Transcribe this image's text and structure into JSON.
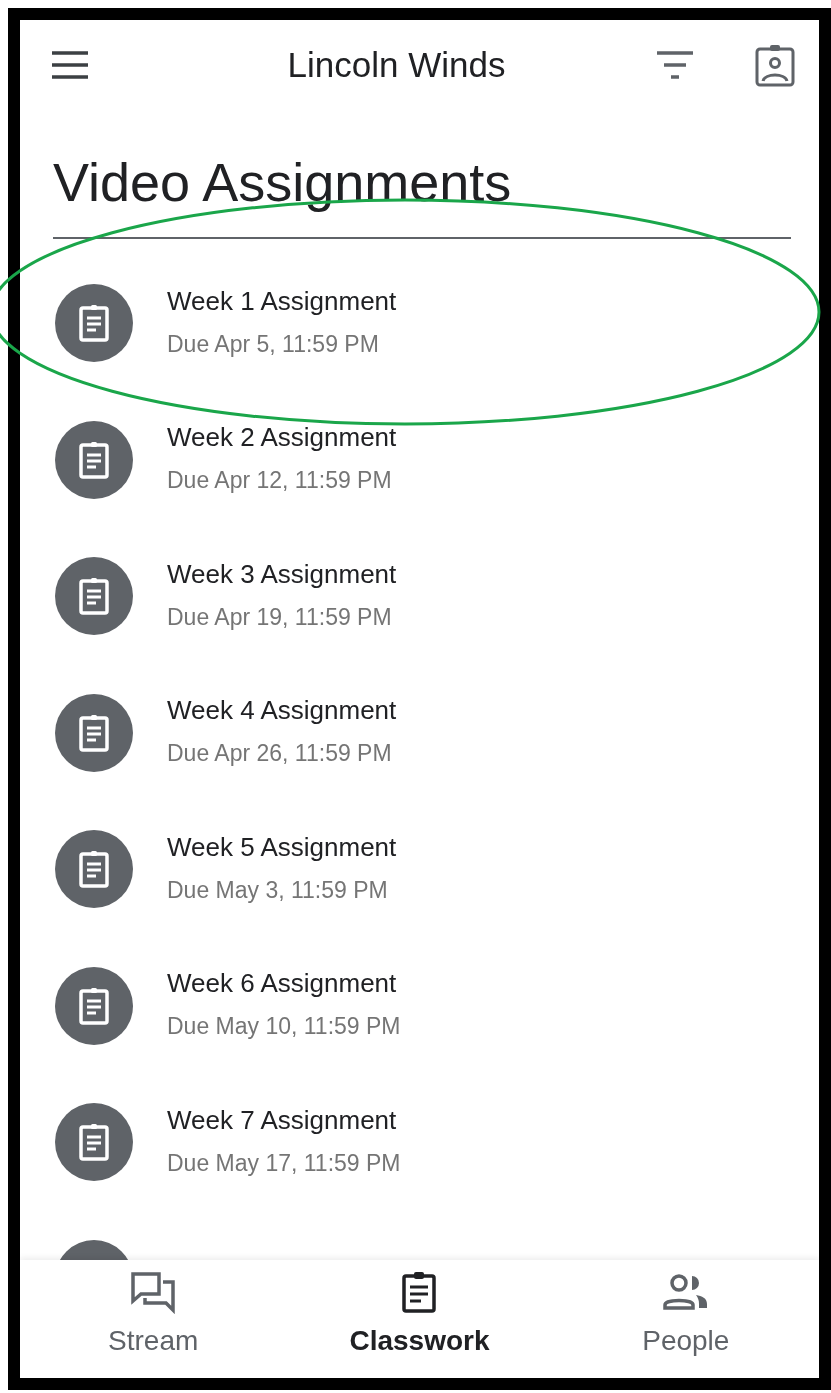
{
  "app_bar": {
    "title": "Lincoln Winds"
  },
  "topic": {
    "title": "Video Assignments"
  },
  "assignments": [
    {
      "title": "Week 1 Assignment",
      "due": "Due Apr 5, 11:59 PM"
    },
    {
      "title": "Week 2 Assignment",
      "due": "Due Apr 12, 11:59 PM"
    },
    {
      "title": "Week 3 Assignment",
      "due": "Due Apr 19, 11:59 PM"
    },
    {
      "title": "Week 4 Assignment",
      "due": "Due Apr 26, 11:59 PM"
    },
    {
      "title": "Week 5 Assignment",
      "due": "Due May 3, 11:59 PM"
    },
    {
      "title": "Week 6 Assignment",
      "due": "Due May 10, 11:59 PM"
    },
    {
      "title": "Week 7 Assignment",
      "due": "Due May 17, 11:59 PM"
    }
  ],
  "bottom_nav": [
    {
      "kind": "stream",
      "label": "Stream",
      "selected": false
    },
    {
      "kind": "classwork",
      "label": "Classwork",
      "selected": true
    },
    {
      "kind": "people",
      "label": "People",
      "selected": false
    }
  ]
}
